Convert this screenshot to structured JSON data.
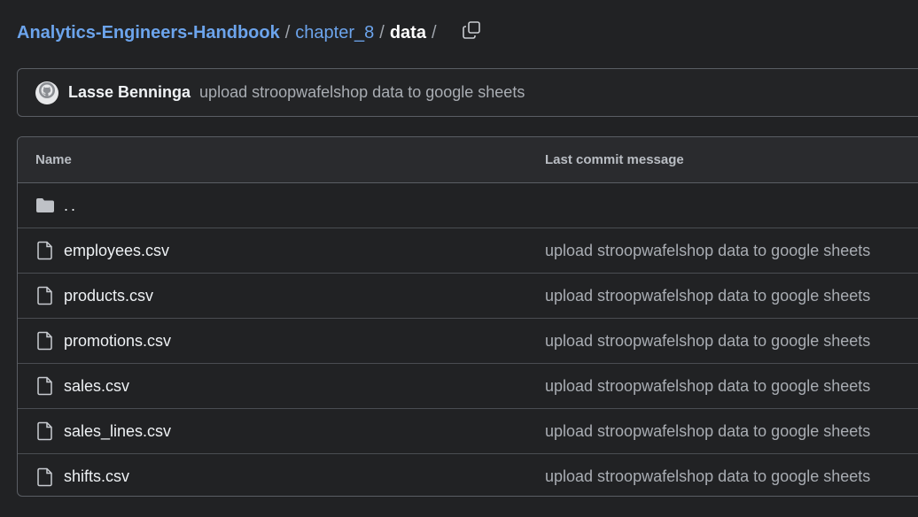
{
  "breadcrumb": {
    "root": "Analytics-Engineers-Handbook",
    "folder": "chapter_8",
    "current": "data",
    "separator": "/"
  },
  "commit": {
    "author": "Lasse Benninga",
    "message": "upload stroopwafelshop data to google sheets"
  },
  "table": {
    "headers": {
      "name": "Name",
      "last_commit_message": "Last commit message"
    },
    "parent_dir": "..",
    "files": [
      {
        "name": "employees.csv",
        "message": "upload stroopwafelshop data to google sheets"
      },
      {
        "name": "products.csv",
        "message": "upload stroopwafelshop data to google sheets"
      },
      {
        "name": "promotions.csv",
        "message": "upload stroopwafelshop data to google sheets"
      },
      {
        "name": "sales.csv",
        "message": "upload stroopwafelshop data to google sheets"
      },
      {
        "name": "sales_lines.csv",
        "message": "upload stroopwafelshop data to google sheets"
      },
      {
        "name": "shifts.csv",
        "message": "upload stroopwafelshop data to google sheets"
      }
    ]
  },
  "icons": {
    "copy": "copy-icon",
    "folder": "folder-icon",
    "file": "file-icon",
    "avatar": "github-avatar-icon"
  },
  "colors": {
    "background": "#212224",
    "link": "#6ca4ec",
    "border": "#5a5e64",
    "muted_text": "#a9adb3"
  }
}
